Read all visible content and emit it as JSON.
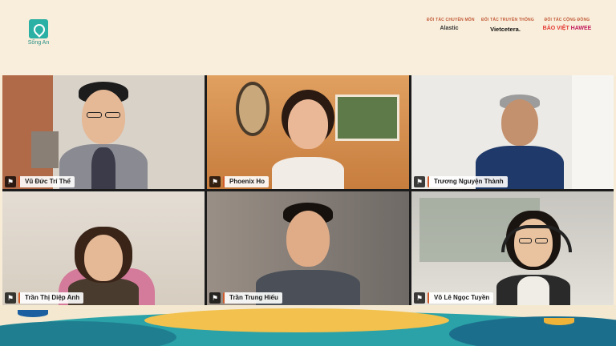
{
  "brand": {
    "name": "Sống An"
  },
  "partners": [
    {
      "title": "ĐỐI TÁC CHUYÊN MÔN",
      "logo": "Alastic"
    },
    {
      "title": "ĐỐI TÁC TRUYỀN THÔNG",
      "logo": "Vietcetera."
    },
    {
      "title": "ĐỐI TÁC CỘNG ĐỒNG",
      "logo": "HAWEE",
      "logo2": "BẢO VIỆT"
    }
  ],
  "participants": [
    {
      "name": "Vũ Đức Trí Thể"
    },
    {
      "name": "Phoenix Ho"
    },
    {
      "name": "Trương Nguyện Thành"
    },
    {
      "name": "Trần Thị Diệp Anh"
    },
    {
      "name": "Trần Trung Hiếu"
    },
    {
      "name": "Võ Lê Ngọc Tuyền"
    }
  ],
  "colors": {
    "accent": "#d25b2b",
    "active_speaker": "#2fa84f",
    "brand_teal": "#2ab0a4"
  },
  "icons": {
    "pin": "pin-icon"
  }
}
